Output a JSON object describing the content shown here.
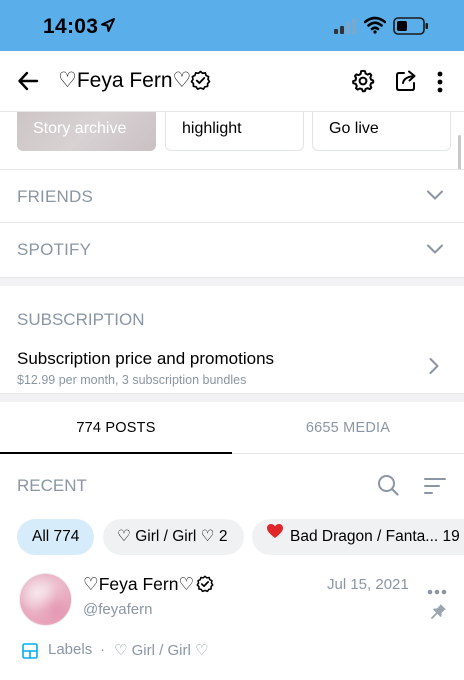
{
  "status_bar": {
    "time": "14:03",
    "background": "#5aaee9",
    "icons": [
      "location-arrow-icon",
      "cellular-signal-icon",
      "wifi-icon",
      "battery-icon"
    ]
  },
  "header": {
    "title": "♡Feya Fern♡",
    "icons": [
      "back-arrow-icon",
      "verified-icon",
      "settings-gear-icon",
      "share-icon",
      "more-vertical-icon"
    ]
  },
  "story_row": {
    "items": [
      "Story archive",
      "highlight",
      "Go live"
    ]
  },
  "sections": {
    "friends": "FRIENDS",
    "spotify": "SPOTIFY"
  },
  "subscription": {
    "title": "SUBSCRIPTION",
    "main": "Subscription price and promotions",
    "detail": "$12.99 per month, 3 subscription bundles"
  },
  "tabs": [
    {
      "label": "774 POSTS",
      "active": true
    },
    {
      "label": "6655 MEDIA",
      "active": false
    }
  ],
  "recent": {
    "title": "RECENT"
  },
  "filters": [
    {
      "label": "All 774",
      "active": true
    },
    {
      "label": "♡ Girl / Girl ♡ 2",
      "active": false
    },
    {
      "label": "Bad Dragon / Fanta... 19",
      "active": false
    }
  ],
  "post": {
    "name": "♡Feya Fern♡",
    "handle": "@feyafern",
    "date": "Jul 15, 2021",
    "labels_caption": "Labels",
    "labels_separator": "·",
    "label_value": "♡ Girl / Girl ♡"
  },
  "colors": {
    "accent": "#00aff0",
    "muted_text": "#8a96a3",
    "active_chip": "#d7ecfa",
    "heart": "#e0252b"
  }
}
